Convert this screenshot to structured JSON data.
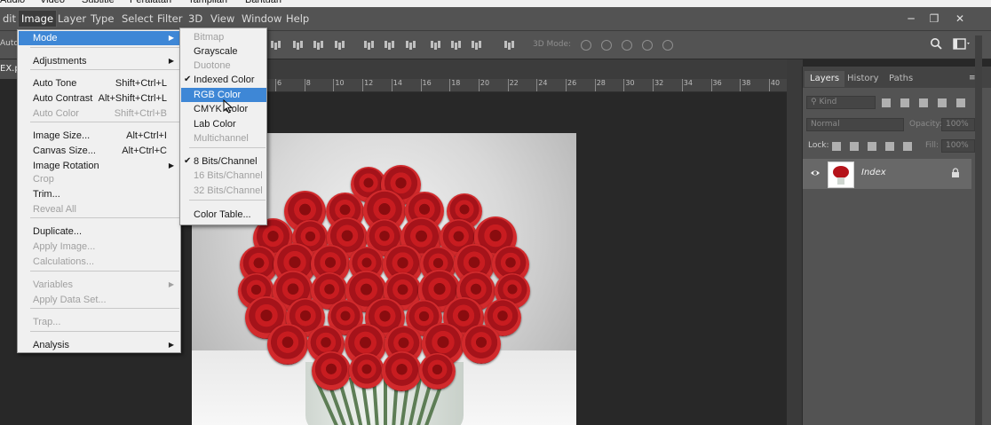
{
  "host_bar": {
    "items": [
      "Audio",
      "Video",
      "Subtitle",
      "Peralatan",
      "Tampilan",
      "Bantuan"
    ]
  },
  "menubar": {
    "items": [
      "dit",
      "Image",
      "Layer",
      "Type",
      "Select",
      "Filter",
      "3D",
      "View",
      "Window",
      "Help"
    ],
    "active": "Image"
  },
  "options_bar": {
    "left_label": "Auto",
    "mode_3d_label": "3D Mode:"
  },
  "document": {
    "tab_label": "EX.p"
  },
  "ruler": {
    "ticks": [
      "6",
      "8",
      "10",
      "12",
      "14",
      "16",
      "18",
      "20",
      "22",
      "24",
      "26",
      "28",
      "30",
      "32",
      "34",
      "36",
      "38",
      "40"
    ]
  },
  "image_menu": {
    "items": [
      {
        "label": "Mode",
        "shortcut": "",
        "submenu": true,
        "disabled": false,
        "highlighted": true
      },
      {
        "label": "Adjustments",
        "shortcut": "",
        "submenu": true,
        "disabled": false,
        "highlighted": false
      },
      {
        "label": "Auto Tone",
        "shortcut": "Shift+Ctrl+L",
        "submenu": false,
        "disabled": false,
        "highlighted": false
      },
      {
        "label": "Auto Contrast",
        "shortcut": "Alt+Shift+Ctrl+L",
        "submenu": false,
        "disabled": false,
        "highlighted": false
      },
      {
        "label": "Auto Color",
        "shortcut": "Shift+Ctrl+B",
        "submenu": false,
        "disabled": true,
        "highlighted": false
      },
      {
        "label": "Image Size...",
        "shortcut": "Alt+Ctrl+I",
        "submenu": false,
        "disabled": false,
        "highlighted": false
      },
      {
        "label": "Canvas Size...",
        "shortcut": "Alt+Ctrl+C",
        "submenu": false,
        "disabled": false,
        "highlighted": false
      },
      {
        "label": "Image Rotation",
        "shortcut": "",
        "submenu": true,
        "disabled": false,
        "highlighted": false
      },
      {
        "label": "Crop",
        "shortcut": "",
        "submenu": false,
        "disabled": true,
        "highlighted": false
      },
      {
        "label": "Trim...",
        "shortcut": "",
        "submenu": false,
        "disabled": false,
        "highlighted": false
      },
      {
        "label": "Reveal All",
        "shortcut": "",
        "submenu": false,
        "disabled": true,
        "highlighted": false
      },
      {
        "label": "Duplicate...",
        "shortcut": "",
        "submenu": false,
        "disabled": false,
        "highlighted": false
      },
      {
        "label": "Apply Image...",
        "shortcut": "",
        "submenu": false,
        "disabled": true,
        "highlighted": false
      },
      {
        "label": "Calculations...",
        "shortcut": "",
        "submenu": false,
        "disabled": true,
        "highlighted": false
      },
      {
        "label": "Variables",
        "shortcut": "",
        "submenu": true,
        "disabled": true,
        "highlighted": false
      },
      {
        "label": "Apply Data Set...",
        "shortcut": "",
        "submenu": false,
        "disabled": true,
        "highlighted": false
      },
      {
        "label": "Trap...",
        "shortcut": "",
        "submenu": false,
        "disabled": true,
        "highlighted": false
      },
      {
        "label": "Analysis",
        "shortcut": "",
        "submenu": true,
        "disabled": false,
        "highlighted": false
      }
    ]
  },
  "mode_submenu": {
    "items": [
      {
        "label": "Bitmap",
        "checked": false,
        "disabled": true,
        "highlighted": false
      },
      {
        "label": "Grayscale",
        "checked": false,
        "disabled": false,
        "highlighted": false
      },
      {
        "label": "Duotone",
        "checked": false,
        "disabled": true,
        "highlighted": false
      },
      {
        "label": "Indexed Color",
        "checked": true,
        "disabled": false,
        "highlighted": false
      },
      {
        "label": "RGB Color",
        "checked": false,
        "disabled": false,
        "highlighted": true
      },
      {
        "label": "CMYK Color",
        "checked": false,
        "disabled": false,
        "highlighted": false
      },
      {
        "label": "Lab Color",
        "checked": false,
        "disabled": false,
        "highlighted": false
      },
      {
        "label": "Multichannel",
        "checked": false,
        "disabled": true,
        "highlighted": false
      },
      {
        "label": "8 Bits/Channel",
        "checked": true,
        "disabled": false,
        "highlighted": false
      },
      {
        "label": "16 Bits/Channel",
        "checked": false,
        "disabled": true,
        "highlighted": false
      },
      {
        "label": "32 Bits/Channel",
        "checked": false,
        "disabled": true,
        "highlighted": false
      },
      {
        "label": "Color Table...",
        "checked": false,
        "disabled": false,
        "highlighted": false
      }
    ]
  },
  "layers_panel": {
    "tabs": [
      "Layers",
      "History",
      "Paths"
    ],
    "active_tab": "Layers",
    "kind_placeholder": "Kind",
    "blend_mode": "Normal",
    "opacity_label": "Opacity:",
    "opacity_value": "100%",
    "lock_label": "Lock:",
    "fill_label": "Fill:",
    "fill_value": "100%",
    "layer_name": "Index"
  },
  "colors": {
    "menu_highlight": "#3e87d6",
    "ui_dark": "#535353"
  }
}
